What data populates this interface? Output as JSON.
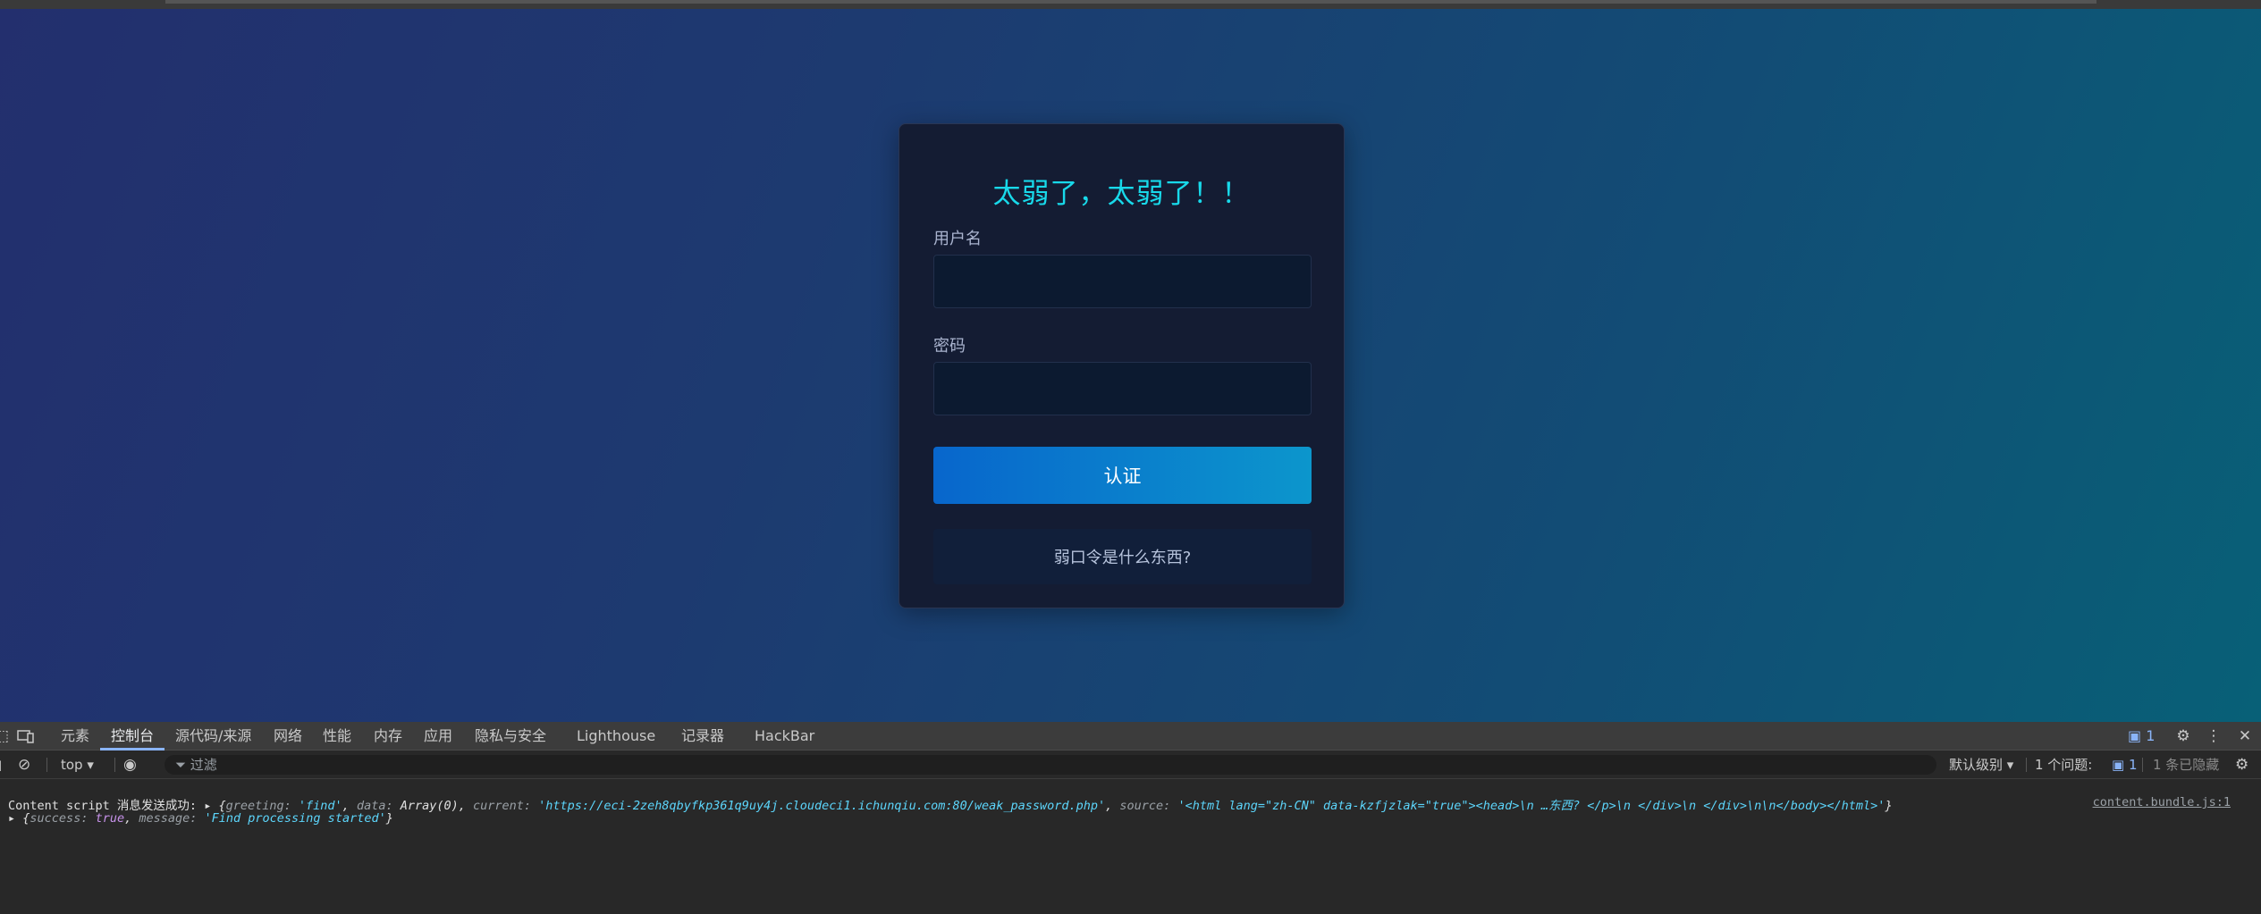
{
  "login": {
    "title": "太弱了，太弱了！！",
    "username_label": "用户名",
    "username_value": "",
    "password_label": "密码",
    "password_value": "",
    "submit_label": "认证",
    "help_label": "弱口令是什么东西?"
  },
  "devtools": {
    "tabs": [
      "元素",
      "控制台",
      "源代码/来源",
      "网络",
      "性能",
      "内存",
      "应用",
      "隐私与安全",
      "Lighthouse",
      "记录器",
      "HackBar"
    ],
    "active_tab": "控制台",
    "issues_badge": "1",
    "toolbar": {
      "context": "top ▾",
      "filter_placeholder": "过滤",
      "level": "默认级别 ▾",
      "issues_label": "1 个问题:",
      "issues_count": "1",
      "hidden_label": "1 条已隐藏"
    },
    "console": {
      "line1_prefix": "Content script 消息发送成功:",
      "line1_obj": {
        "open": "{",
        "k_greeting": "greeting: ",
        "v_greeting": "'find'",
        "k_data": "data: ",
        "v_data": "Array(0)",
        "k_current": "current: ",
        "v_current": "'https://eci-2zeh8qbyfkp361q9uy4j.cloudeci1.ichunqiu.com:80/weak_password.php'",
        "k_source": "source: ",
        "v_source": "'<html lang=\"zh-CN\" data-kzfjzlak=\"true\"><head>\\n    …东西? </p>\\n          </div>\\n      </div>\\n\\n</body></html>'",
        "close": "}"
      },
      "line1_source": "content.bundle.js:1",
      "line2": {
        "open": "{",
        "k_success": "success: ",
        "v_success": "true",
        "k_message": "message: ",
        "v_message": "'Find processing started'",
        "close": "}"
      }
    }
  }
}
